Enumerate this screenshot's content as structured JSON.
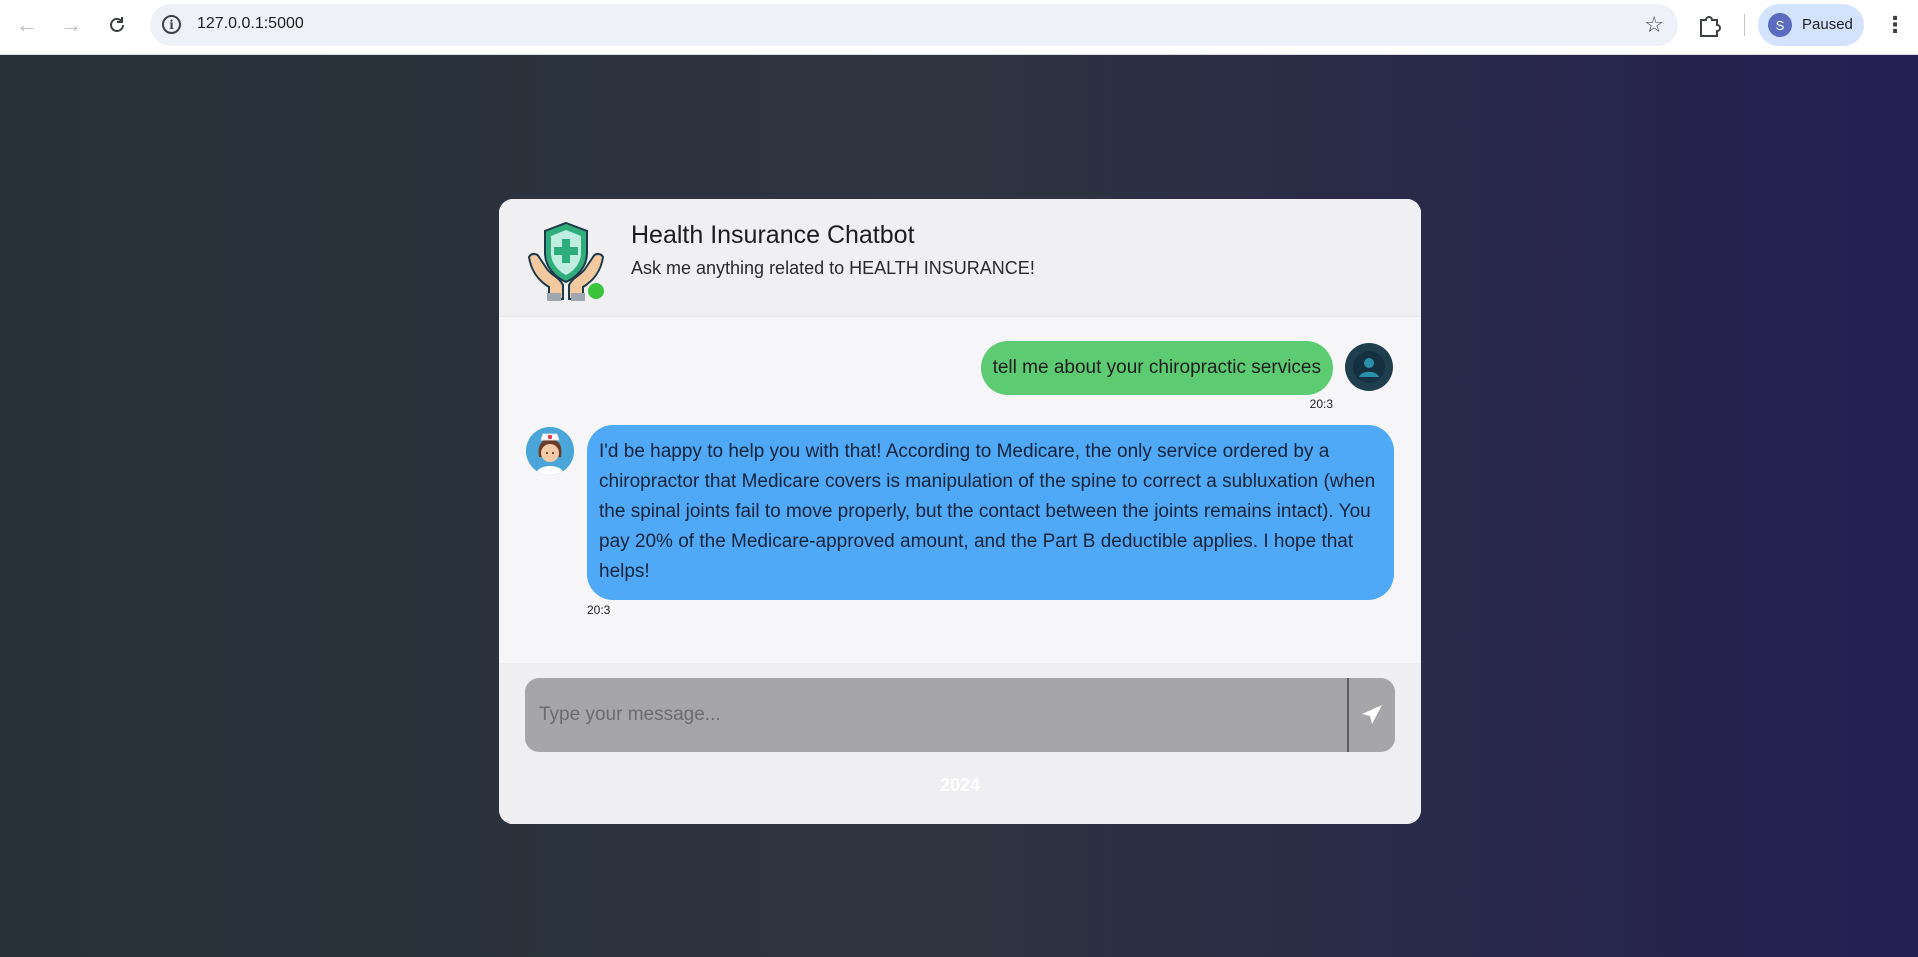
{
  "browser": {
    "url": "127.0.0.1:5000",
    "profile_initial": "S",
    "profile_status": "Paused"
  },
  "chat": {
    "title": "Health Insurance Chatbot",
    "subtitle": "Ask me anything related to HEALTH INSURANCE!",
    "messages": [
      {
        "sender": "user",
        "text": "tell me about your chiropractic services",
        "time": "20:3"
      },
      {
        "sender": "bot",
        "text": "I'd be happy to help you with that! According to Medicare, the only service ordered by a chiropractor that Medicare covers is manipulation of the spine to correct a subluxation (when the spinal joints fail to move properly, but the contact between the joints remains intact). You pay 20% of the Medicare-approved amount, and the Part B deductible applies. I hope that helps!",
        "time": "20:3"
      }
    ],
    "input_placeholder": "Type your message...",
    "footer_text": "2024"
  },
  "colors": {
    "user_bubble": "#5ccb71",
    "bot_bubble": "#4fa9f7",
    "online": "#3cc53c"
  }
}
